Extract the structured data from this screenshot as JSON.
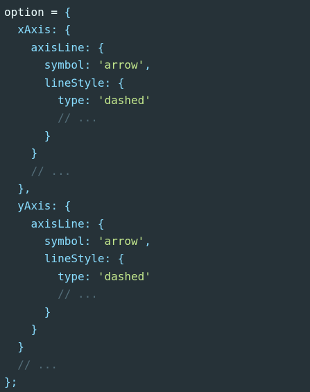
{
  "colors": {
    "background": "#263238",
    "text": "#eeffff",
    "key": "#89ddff",
    "punctuation": "#89ddff",
    "string": "#c3e88d",
    "comment": "#546e7a"
  },
  "code_lines": [
    [
      {
        "t": "plain",
        "v": "option = "
      },
      {
        "t": "punct",
        "v": "{"
      }
    ],
    [
      {
        "t": "indent",
        "v": "  "
      },
      {
        "t": "key",
        "v": "xAxis"
      },
      {
        "t": "punct",
        "v": ": {"
      }
    ],
    [
      {
        "t": "indent",
        "v": "    "
      },
      {
        "t": "key",
        "v": "axisLine"
      },
      {
        "t": "punct",
        "v": ": {"
      }
    ],
    [
      {
        "t": "indent",
        "v": "      "
      },
      {
        "t": "key",
        "v": "symbol"
      },
      {
        "t": "punct",
        "v": ": "
      },
      {
        "t": "string",
        "v": "'arrow'"
      },
      {
        "t": "punct",
        "v": ","
      }
    ],
    [
      {
        "t": "indent",
        "v": "      "
      },
      {
        "t": "key",
        "v": "lineStyle"
      },
      {
        "t": "punct",
        "v": ": {"
      }
    ],
    [
      {
        "t": "indent",
        "v": "        "
      },
      {
        "t": "key",
        "v": "type"
      },
      {
        "t": "punct",
        "v": ": "
      },
      {
        "t": "string",
        "v": "'dashed'"
      }
    ],
    [
      {
        "t": "indent",
        "v": "        "
      },
      {
        "t": "comment",
        "v": "// ..."
      }
    ],
    [
      {
        "t": "indent",
        "v": "      "
      },
      {
        "t": "punct",
        "v": "}"
      }
    ],
    [
      {
        "t": "indent",
        "v": "    "
      },
      {
        "t": "punct",
        "v": "}"
      }
    ],
    [
      {
        "t": "indent",
        "v": "    "
      },
      {
        "t": "comment",
        "v": "// ..."
      }
    ],
    [
      {
        "t": "indent",
        "v": "  "
      },
      {
        "t": "punct",
        "v": "},"
      }
    ],
    [
      {
        "t": "indent",
        "v": "  "
      },
      {
        "t": "key",
        "v": "yAxis"
      },
      {
        "t": "punct",
        "v": ": {"
      }
    ],
    [
      {
        "t": "indent",
        "v": "    "
      },
      {
        "t": "key",
        "v": "axisLine"
      },
      {
        "t": "punct",
        "v": ": {"
      }
    ],
    [
      {
        "t": "indent",
        "v": "      "
      },
      {
        "t": "key",
        "v": "symbol"
      },
      {
        "t": "punct",
        "v": ": "
      },
      {
        "t": "string",
        "v": "'arrow'"
      },
      {
        "t": "punct",
        "v": ","
      }
    ],
    [
      {
        "t": "indent",
        "v": "      "
      },
      {
        "t": "key",
        "v": "lineStyle"
      },
      {
        "t": "punct",
        "v": ": {"
      }
    ],
    [
      {
        "t": "indent",
        "v": "        "
      },
      {
        "t": "key",
        "v": "type"
      },
      {
        "t": "punct",
        "v": ": "
      },
      {
        "t": "string",
        "v": "'dashed'"
      }
    ],
    [
      {
        "t": "indent",
        "v": "        "
      },
      {
        "t": "comment",
        "v": "// ..."
      }
    ],
    [
      {
        "t": "indent",
        "v": "      "
      },
      {
        "t": "punct",
        "v": "}"
      }
    ],
    [
      {
        "t": "indent",
        "v": "    "
      },
      {
        "t": "punct",
        "v": "}"
      }
    ],
    [
      {
        "t": "indent",
        "v": "  "
      },
      {
        "t": "punct",
        "v": "}"
      }
    ],
    [
      {
        "t": "indent",
        "v": "  "
      },
      {
        "t": "comment",
        "v": "// ..."
      }
    ],
    [
      {
        "t": "punct",
        "v": "};"
      }
    ]
  ]
}
